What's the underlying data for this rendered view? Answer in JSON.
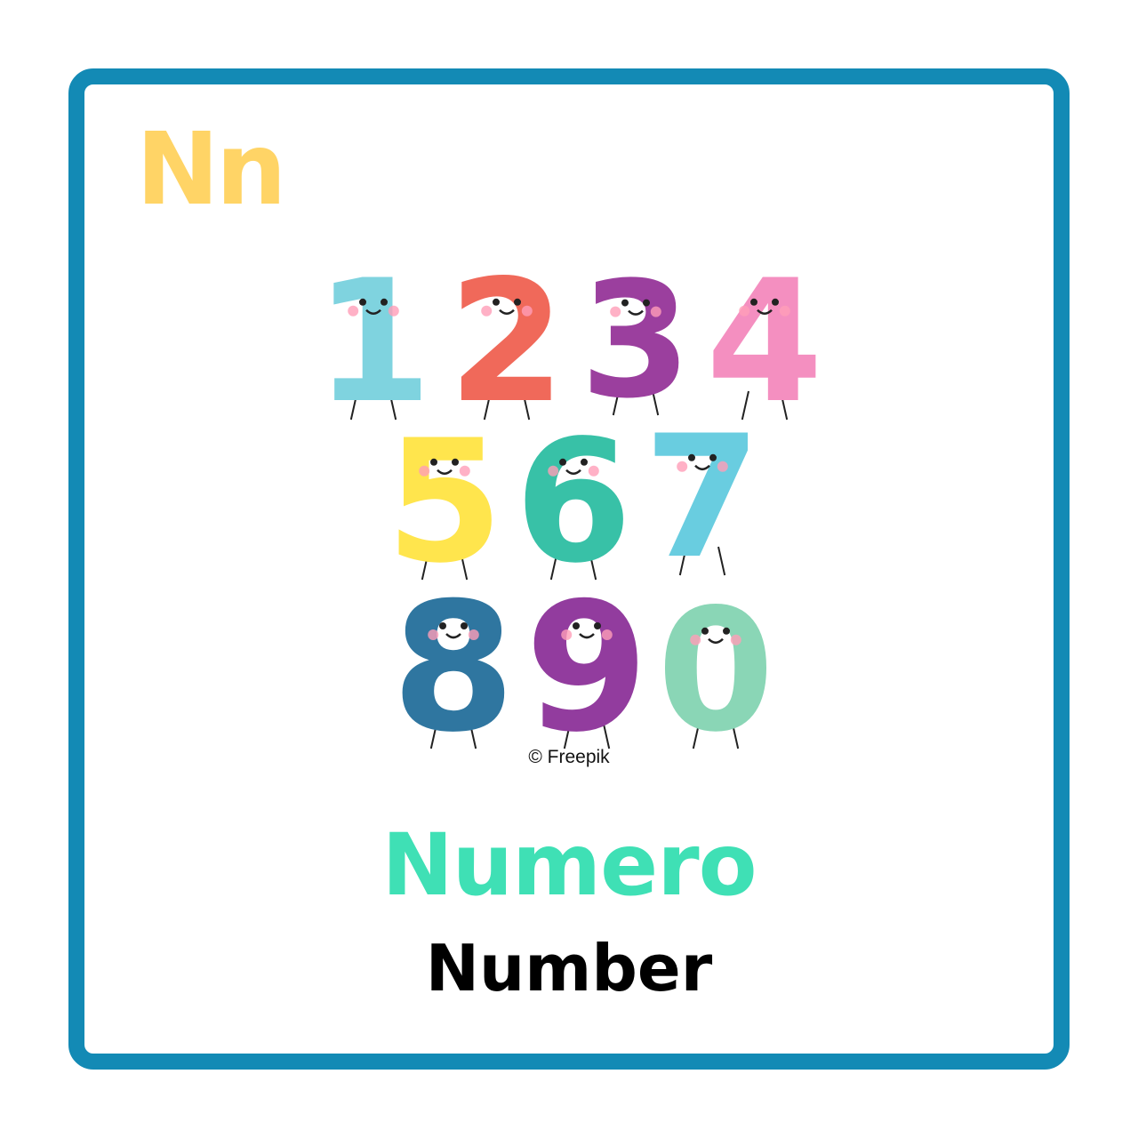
{
  "card": {
    "letter_pair": "Nn",
    "word_primary": "Numero",
    "word_secondary": "Number",
    "credit": "© Freepik"
  },
  "colors": {
    "border": "#138ab5",
    "letter": "#ffd466",
    "word_primary": "#3fe0b5",
    "word_secondary": "#000000"
  },
  "illustration": {
    "digits": [
      {
        "glyph": "1",
        "color": "#7fd3df"
      },
      {
        "glyph": "2",
        "color": "#f0695a"
      },
      {
        "glyph": "3",
        "color": "#9b3f9e"
      },
      {
        "glyph": "4",
        "color": "#f48fc0"
      },
      {
        "glyph": "5",
        "color": "#ffe54d"
      },
      {
        "glyph": "6",
        "color": "#38c1a7"
      },
      {
        "glyph": "7",
        "color": "#69cde0"
      },
      {
        "glyph": "8",
        "color": "#2f76a0"
      },
      {
        "glyph": "9",
        "color": "#923c9e"
      },
      {
        "glyph": "0",
        "color": "#8ad6b6"
      }
    ]
  }
}
